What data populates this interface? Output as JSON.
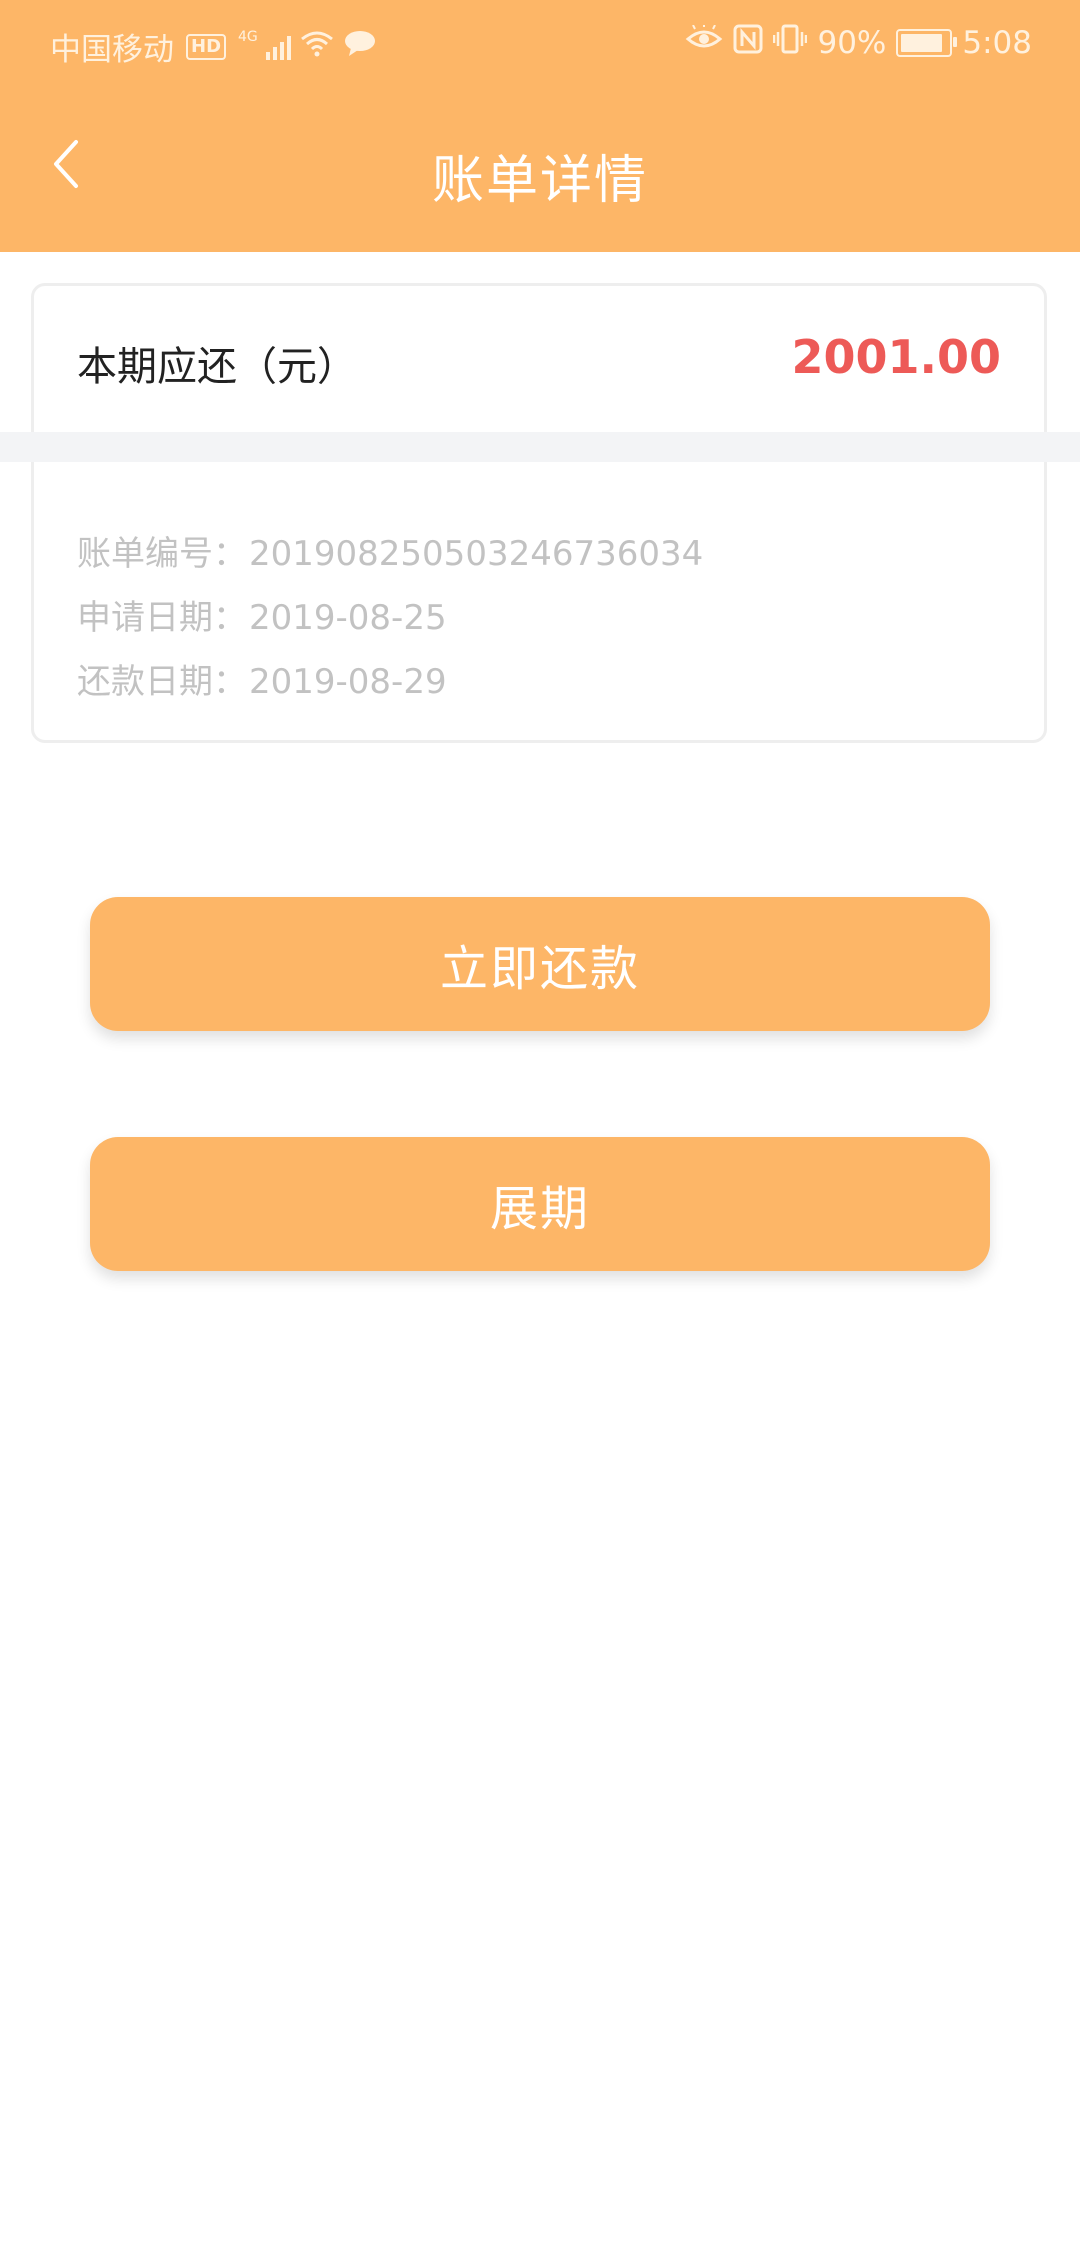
{
  "status_bar": {
    "carrier": "中国移动",
    "hd_badge": "HD",
    "network_type": "4G",
    "battery_percent": "90%",
    "battery_level": 0.9,
    "time": "5:08"
  },
  "header": {
    "title": "账单详情",
    "back_icon": "chevron-left-icon",
    "background_color": "#fdb667"
  },
  "bill": {
    "due_label": "本期应还（元）",
    "due_amount": "2001.00",
    "amount_color": "#ed5a57",
    "details": [
      {
        "label": "账单编号：",
        "value": "20190825050324673603​4"
      },
      {
        "label": "申请日期：",
        "value": "2019-08-25"
      },
      {
        "label": "还款日期：",
        "value": "2019-08-29"
      }
    ]
  },
  "actions": {
    "repay_label": "立即还款",
    "extend_label": "展期",
    "button_color": "#fdb667"
  }
}
